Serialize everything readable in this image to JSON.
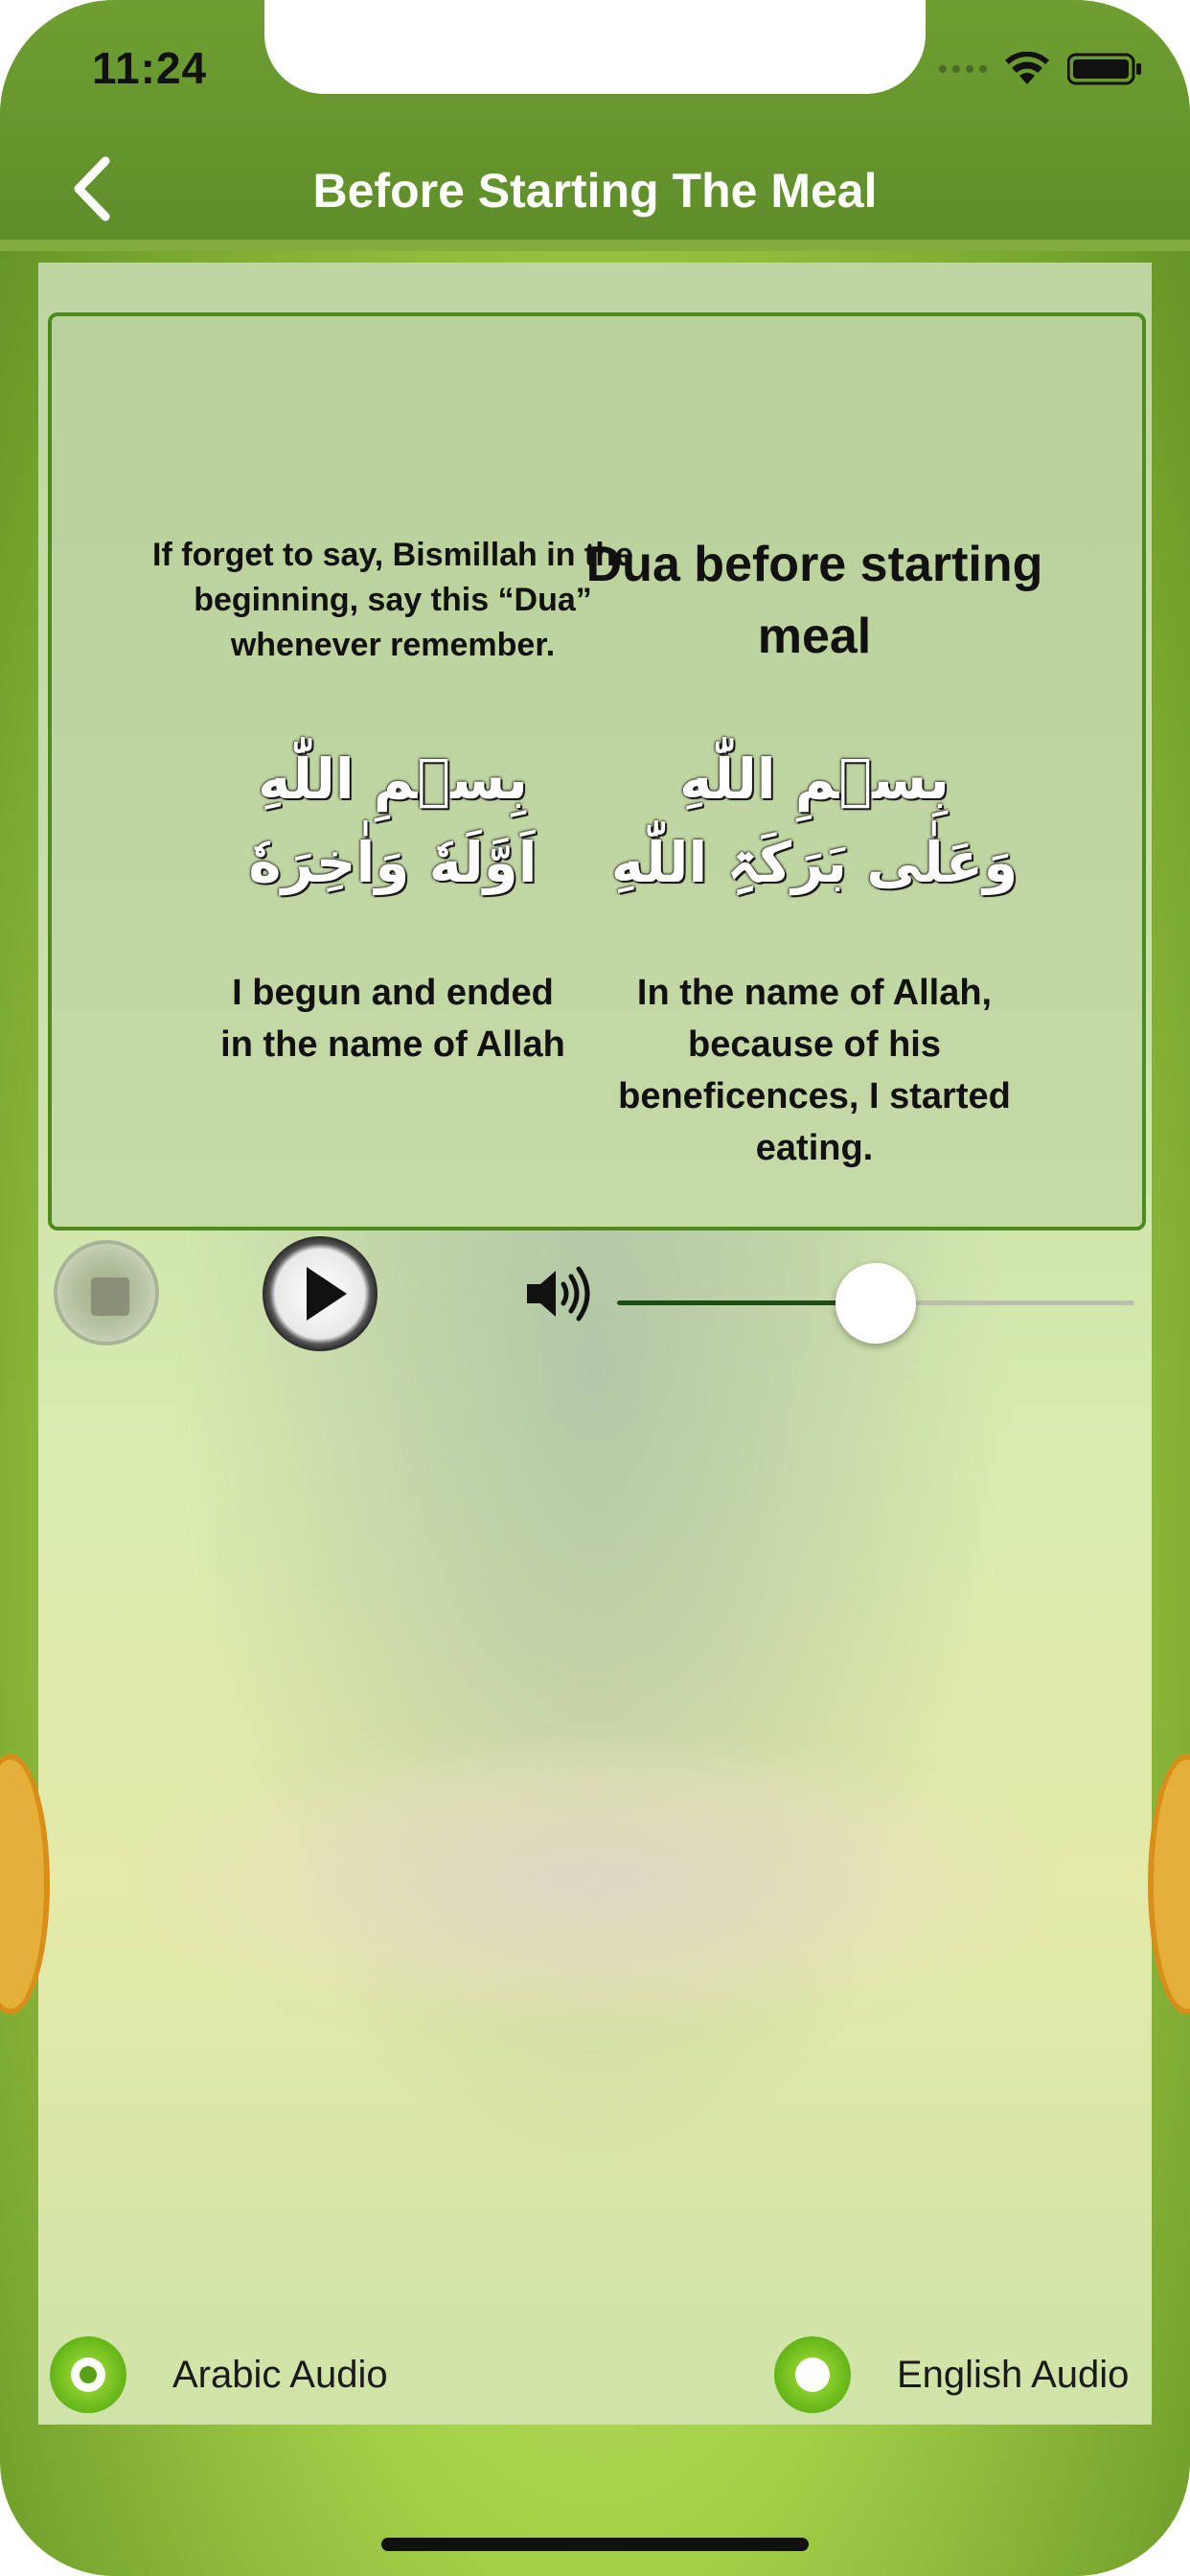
{
  "status_bar": {
    "time": "11:24"
  },
  "header": {
    "title": "Before Starting The Meal"
  },
  "card": {
    "left": {
      "note": "If forget to say, Bismillah in the beginning, say this “Dua” whenever remember.",
      "arabic_line1": "بِسۡمِ اللّٰهِ",
      "arabic_line2": "اَوَّلَهٗ وَاٰخِرَهٗ",
      "translation": "I begun and ended in the name of Allah"
    },
    "right": {
      "heading": "Dua before starting meal",
      "arabic_line1": "بِسۡمِ اللّٰهِ",
      "arabic_line2": "وَعَلٰی بَرَکَۃِ اللّٰهِ",
      "translation": "In the name of Allah, because of his beneficences, I started eating."
    }
  },
  "player": {
    "volume_fraction": 0.5,
    "icons": {
      "stop": "stop-icon",
      "play": "play-icon",
      "volume": "speaker-icon"
    }
  },
  "audio_options": [
    {
      "label": "Arabic Audio",
      "selected": true
    },
    {
      "label": "English Audio",
      "selected": false
    }
  ],
  "colors": {
    "header_green": "#6f9f31",
    "accent_green": "#5aa016",
    "slider_fill": "#1e4d16"
  }
}
